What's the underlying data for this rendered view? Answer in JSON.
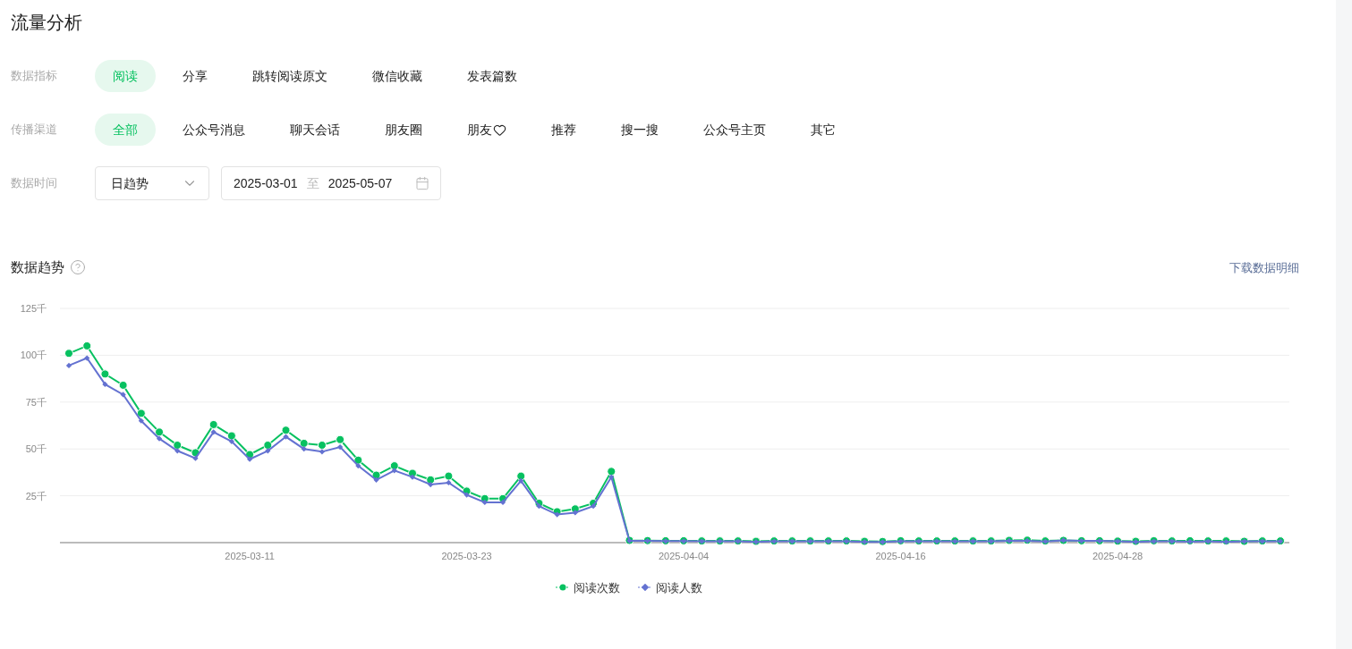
{
  "page_title": "流量分析",
  "filters": [
    {
      "label": "数据指标",
      "options": [
        {
          "label": "阅读",
          "selected": true
        },
        {
          "label": "分享",
          "selected": false
        },
        {
          "label": "跳转阅读原文",
          "selected": false
        },
        {
          "label": "微信收藏",
          "selected": false
        },
        {
          "label": "发表篇数",
          "selected": false
        }
      ]
    },
    {
      "label": "传播渠道",
      "options": [
        {
          "label": "全部",
          "selected": true
        },
        {
          "label": "公众号消息",
          "selected": false
        },
        {
          "label": "聊天会话",
          "selected": false
        },
        {
          "label": "朋友圈",
          "selected": false
        },
        {
          "label": "朋友",
          "selected": false,
          "kind": "heart"
        },
        {
          "label": "推荐",
          "selected": false
        },
        {
          "label": "搜一搜",
          "selected": false
        },
        {
          "label": "公众号主页",
          "selected": false
        },
        {
          "label": "其它",
          "selected": false
        }
      ]
    }
  ],
  "time": {
    "label": "数据时间",
    "granularity": "日趋势",
    "start": "2025-03-01",
    "separator": "至",
    "end": "2025-05-07"
  },
  "trend": {
    "title": "数据趋势",
    "download": "下载数据明细",
    "chart_data": {
      "type": "line",
      "ylim": [
        0,
        125
      ],
      "grid": true,
      "categories": [
        null,
        null,
        null,
        null,
        null,
        null,
        null,
        null,
        null,
        null,
        "2025-03-11",
        null,
        null,
        null,
        null,
        null,
        null,
        null,
        null,
        null,
        null,
        null,
        "2025-03-23",
        null,
        null,
        null,
        null,
        null,
        null,
        null,
        null,
        null,
        null,
        null,
        "2025-04-04",
        null,
        null,
        null,
        null,
        null,
        null,
        null,
        null,
        null,
        null,
        null,
        "2025-04-16",
        null,
        null,
        null,
        null,
        null,
        null,
        null,
        null,
        null,
        null,
        null,
        "2025-04-28",
        null,
        null,
        null,
        null,
        null,
        null,
        null,
        null,
        null
      ],
      "yticks": [
        {
          "value": 25,
          "label": "25千"
        },
        {
          "value": 50,
          "label": "50千"
        },
        {
          "value": 75,
          "label": "75千"
        },
        {
          "value": 100,
          "label": "100千"
        },
        {
          "value": 125,
          "label": "125千"
        }
      ],
      "series": [
        {
          "name": "阅读次数",
          "color": "#07c160",
          "marker": "circle",
          "values": [
            101,
            105,
            90,
            84,
            69,
            59,
            52,
            48,
            63,
            57,
            47,
            52,
            60,
            53,
            52,
            55,
            44,
            36,
            41,
            37,
            33.5,
            35.5,
            27.5,
            23.5,
            23.5,
            35.5,
            21,
            16.5,
            18,
            21,
            38,
            1.2,
            1.1,
            1.0,
            1.0,
            0.9,
            0.9,
            0.9,
            0.7,
            0.9,
            0.9,
            0.9,
            0.9,
            0.9,
            0.7,
            0.6,
            1.0,
            0.9,
            0.9,
            0.9,
            0.9,
            0.9,
            1.2,
            1.3,
            0.9,
            1.2,
            1.0,
            1.0,
            0.8,
            0.7,
            1.0,
            0.9,
            1.0,
            0.9,
            0.9,
            0.7,
            0.9,
            0.9
          ]
        },
        {
          "name": "阅读人数",
          "color": "#6472d1",
          "marker": "diamond",
          "values": [
            94.5,
            98.5,
            84.5,
            79,
            65,
            55.5,
            49,
            45,
            59,
            54,
            44.5,
            49,
            56.5,
            50,
            48.5,
            51,
            41,
            33.5,
            38.5,
            35,
            31,
            32,
            25.5,
            21.5,
            21.5,
            33,
            19.5,
            15,
            16,
            19.5,
            35,
            1.0,
            0.9,
            0.8,
            0.8,
            0.7,
            0.7,
            0.7,
            0.4,
            0.7,
            0.7,
            0.7,
            0.7,
            0.7,
            0.4,
            0.3,
            0.7,
            0.7,
            0.7,
            0.7,
            0.7,
            0.7,
            1.0,
            1.0,
            0.6,
            1.2,
            0.9,
            0.9,
            0.7,
            0.4,
            0.7,
            0.7,
            0.5,
            0.7,
            0.4,
            0.7,
            0.7,
            0.7
          ]
        }
      ]
    }
  }
}
